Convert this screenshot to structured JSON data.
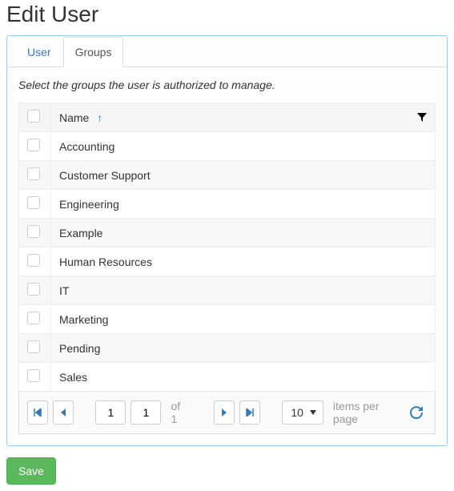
{
  "title": "Edit User",
  "tabs": [
    {
      "label": "User",
      "active": false
    },
    {
      "label": "Groups",
      "active": true
    }
  ],
  "instruction": "Select the groups the user is authorized to manage.",
  "table": {
    "header_name": "Name",
    "rows": [
      {
        "name": "Accounting"
      },
      {
        "name": "Customer Support"
      },
      {
        "name": "Engineering"
      },
      {
        "name": "Example"
      },
      {
        "name": "Human Resources"
      },
      {
        "name": "IT"
      },
      {
        "name": "Marketing"
      },
      {
        "name": "Pending"
      },
      {
        "name": "Sales"
      }
    ]
  },
  "pager": {
    "page": "1",
    "page2": "1",
    "of_text": "of 1",
    "pagesize": "10",
    "items_label": "items per page"
  },
  "buttons": {
    "save": "Save"
  }
}
